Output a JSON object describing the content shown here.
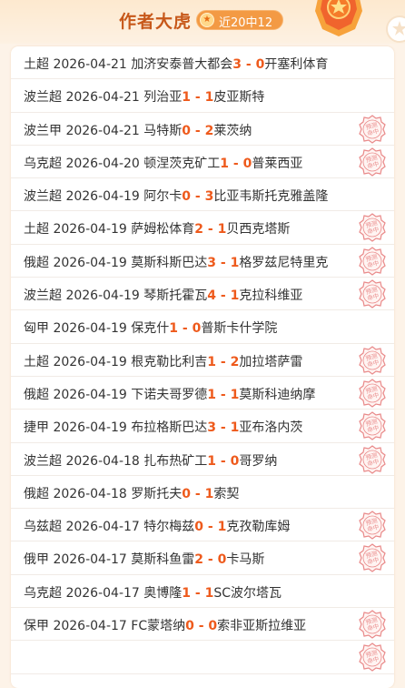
{
  "header": {
    "title": "作者大虎",
    "streak_label": "近20中12",
    "star_glyph": "★"
  },
  "stamp_text": "预测命中",
  "matches": [
    {
      "text": "土超 2026-04-21 加济安泰普大都会",
      "home_score": "3",
      "sep": " - ",
      "away_score": "0",
      "away": "开塞利体育",
      "hit": false
    },
    {
      "text": "波兰超 2026-04-21 列治亚",
      "home_score": "1",
      "sep": " - ",
      "away_score": "1",
      "away": "皮亚斯特",
      "hit": false
    },
    {
      "text": "波兰甲 2026-04-21 马特斯",
      "home_score": "0",
      "sep": " - ",
      "away_score": "2",
      "away": "莱茨纳",
      "hit": true
    },
    {
      "text": "乌克超 2026-04-20 顿涅茨克矿工",
      "home_score": "1",
      "sep": " - ",
      "away_score": "0",
      "away": "普莱西亚",
      "hit": true
    },
    {
      "text": "波兰超 2026-04-19 阿尔卡",
      "home_score": "0",
      "sep": " - ",
      "away_score": "3",
      "away": "比亚韦斯托克雅盖隆",
      "hit": false
    },
    {
      "text": "土超 2026-04-19 萨姆松体育",
      "home_score": "2",
      "sep": " - ",
      "away_score": "1",
      "away": "贝西克塔斯",
      "hit": true
    },
    {
      "text": "俄超 2026-04-19 莫斯科斯巴达",
      "home_score": "3",
      "sep": " - ",
      "away_score": "1",
      "away": "格罗兹尼特里克",
      "hit": true
    },
    {
      "text": "波兰超 2026-04-19 琴斯托霍瓦",
      "home_score": "4",
      "sep": " - ",
      "away_score": "1",
      "away": "克拉科维亚",
      "hit": true
    },
    {
      "text": "匈甲 2026-04-19 保克什",
      "home_score": "1",
      "sep": " - ",
      "away_score": "0",
      "away": "普斯卡什学院",
      "hit": false
    },
    {
      "text": "土超 2026-04-19 根克勒比利吉",
      "home_score": "1",
      "sep": " - ",
      "away_score": "2",
      "away": "加拉塔萨雷",
      "hit": true
    },
    {
      "text": "俄超 2026-04-19 下诺夫哥罗德",
      "home_score": "1",
      "sep": " - ",
      "away_score": "1",
      "away": "莫斯科迪纳摩",
      "hit": true
    },
    {
      "text": "捷甲 2026-04-19 布拉格斯巴达",
      "home_score": "3",
      "sep": " - ",
      "away_score": "1",
      "away": "亚布洛内茨",
      "hit": true
    },
    {
      "text": "波兰超 2026-04-18 扎布热矿工",
      "home_score": "1",
      "sep": " - ",
      "away_score": "0",
      "away": "哥罗纳",
      "hit": true
    },
    {
      "text": "俄超 2026-04-18 罗斯托夫",
      "home_score": "0",
      "sep": " - ",
      "away_score": "1",
      "away": "索契",
      "hit": false
    },
    {
      "text": "乌兹超 2026-04-17 特尔梅兹",
      "home_score": "0",
      "sep": " - ",
      "away_score": "1",
      "away": "克孜勒库姆",
      "hit": true
    },
    {
      "text": "俄甲 2026-04-17 莫斯科鱼雷",
      "home_score": "2",
      "sep": " - ",
      "away_score": "0",
      "away": "卡马斯",
      "hit": true
    },
    {
      "text": "乌克超 2026-04-17 奥博隆",
      "home_score": "1",
      "sep": " - ",
      "away_score": "1",
      "away": "SC波尔塔瓦",
      "hit": false
    },
    {
      "text": "保甲 2026-04-17 FC蒙塔纳",
      "home_score": "0",
      "sep": " - ",
      "away_score": "0",
      "away": "索非亚斯拉维亚",
      "hit": true
    },
    {
      "text": "",
      "home_score": "",
      "sep": "",
      "away_score": "",
      "away": "",
      "hit": true
    }
  ],
  "colors": {
    "score": "#ee5a1c",
    "title": "#c7581a",
    "pill": "#f39a44",
    "stamp": "#e98a8a"
  }
}
